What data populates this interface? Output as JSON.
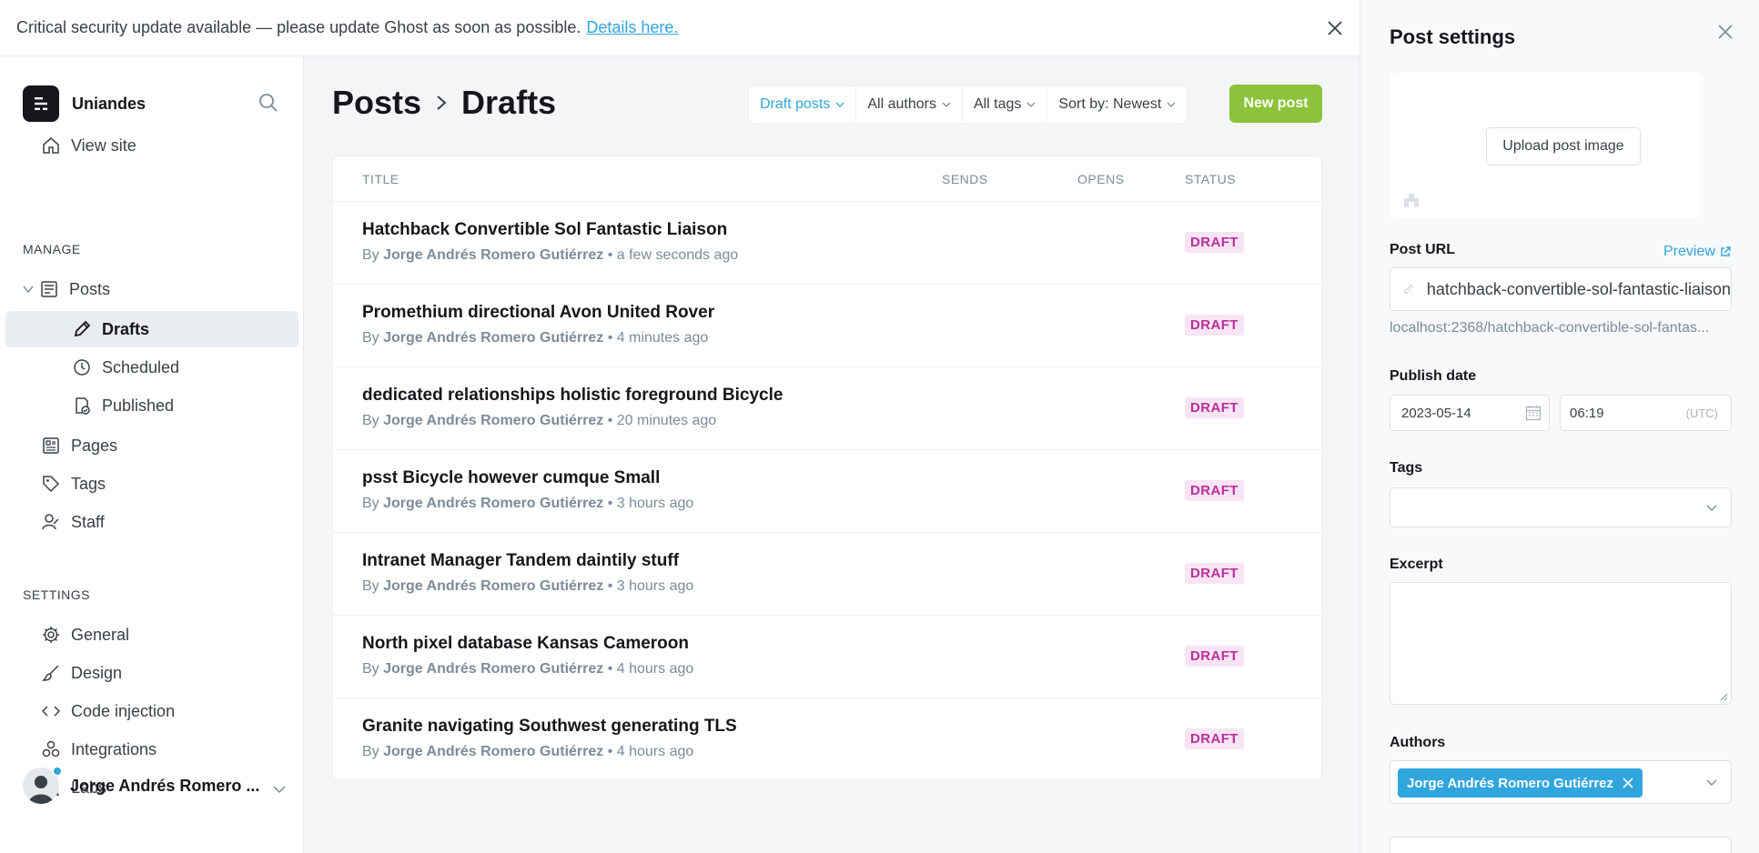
{
  "banner": {
    "text": "Critical security update available — please update Ghost as soon as possible.",
    "link": "Details here."
  },
  "sidebar": {
    "brand": "Uniandes",
    "view_site": "View site",
    "manage_label": "MANAGE",
    "posts": "Posts",
    "drafts": "Drafts",
    "scheduled": "Scheduled",
    "published": "Published",
    "pages": "Pages",
    "tags": "Tags",
    "staff": "Staff",
    "settings_label": "SETTINGS",
    "general": "General",
    "design": "Design",
    "code_injection": "Code injection",
    "integrations": "Integrations",
    "labs": "Labs",
    "user_name": "Jorge Andrés Romero ..."
  },
  "main": {
    "title_parent": "Posts",
    "title_current": "Drafts",
    "filters": [
      "Draft posts",
      "All authors",
      "All tags",
      "Sort by: Newest"
    ],
    "new_post": "New post",
    "columns": {
      "title": "TITLE",
      "sends": "SENDS",
      "opens": "OPENS",
      "status": "STATUS"
    },
    "posts": [
      {
        "title": "Hatchback Convertible Sol Fantastic Liaison",
        "by": "By",
        "author": "Jorge Andrés Romero Gutiérrez",
        "time": "• a few seconds ago",
        "status": "DRAFT"
      },
      {
        "title": "Promethium directional Avon United Rover",
        "by": "By",
        "author": "Jorge Andrés Romero Gutiérrez",
        "time": "• 4 minutes ago",
        "status": "DRAFT"
      },
      {
        "title": "dedicated relationships holistic foreground Bicycle",
        "by": "By",
        "author": "Jorge Andrés Romero Gutiérrez",
        "time": "• 20 minutes ago",
        "status": "DRAFT"
      },
      {
        "title": "psst Bicycle however cumque Small",
        "by": "By",
        "author": "Jorge Andrés Romero Gutiérrez",
        "time": "• 3 hours ago",
        "status": "DRAFT"
      },
      {
        "title": "Intranet Manager Tandem daintily stuff",
        "by": "By",
        "author": "Jorge Andrés Romero Gutiérrez",
        "time": "• 3 hours ago",
        "status": "DRAFT"
      },
      {
        "title": "North pixel database Kansas Cameroon",
        "by": "By",
        "author": "Jorge Andrés Romero Gutiérrez",
        "time": "• 4 hours ago",
        "status": "DRAFT"
      },
      {
        "title": "Granite navigating Southwest generating TLS",
        "by": "By",
        "author": "Jorge Andrés Romero Gutiérrez",
        "time": "• 4 hours ago",
        "status": "DRAFT"
      }
    ]
  },
  "panel": {
    "title": "Post settings",
    "upload_image": "Upload post image",
    "url_label": "Post URL",
    "preview": "Preview",
    "url_value": "hatchback-convertible-sol-fantastic-liaison",
    "url_hint": "localhost:2368/hatchback-convertible-sol-fantas...",
    "publish_label": "Publish date",
    "date_value": "2023-05-14",
    "time_value": "06:19",
    "timezone": "(UTC)",
    "tags_label": "Tags",
    "excerpt_label": "Excerpt",
    "authors_label": "Authors",
    "author_chip": "Jorge Andrés Romero Gutiérrez"
  },
  "colors": {
    "accent": "#30a5de",
    "new_post_green": "#8cc33b",
    "draft_badge_bg": "#f9e4f3",
    "draft_badge_text": "#b9309d"
  },
  "icons": [
    "close-icon",
    "search-icon",
    "home-icon",
    "posts-icon",
    "pencil-icon",
    "clock-icon",
    "published-icon",
    "pages-icon",
    "tag-icon",
    "staff-icon",
    "gear-icon",
    "brush-icon",
    "code-icon",
    "integrations-icon",
    "flask-icon",
    "chevron-down-icon",
    "chevron-right-icon",
    "link-icon",
    "external-link-icon",
    "calendar-icon",
    "image-icon"
  ]
}
